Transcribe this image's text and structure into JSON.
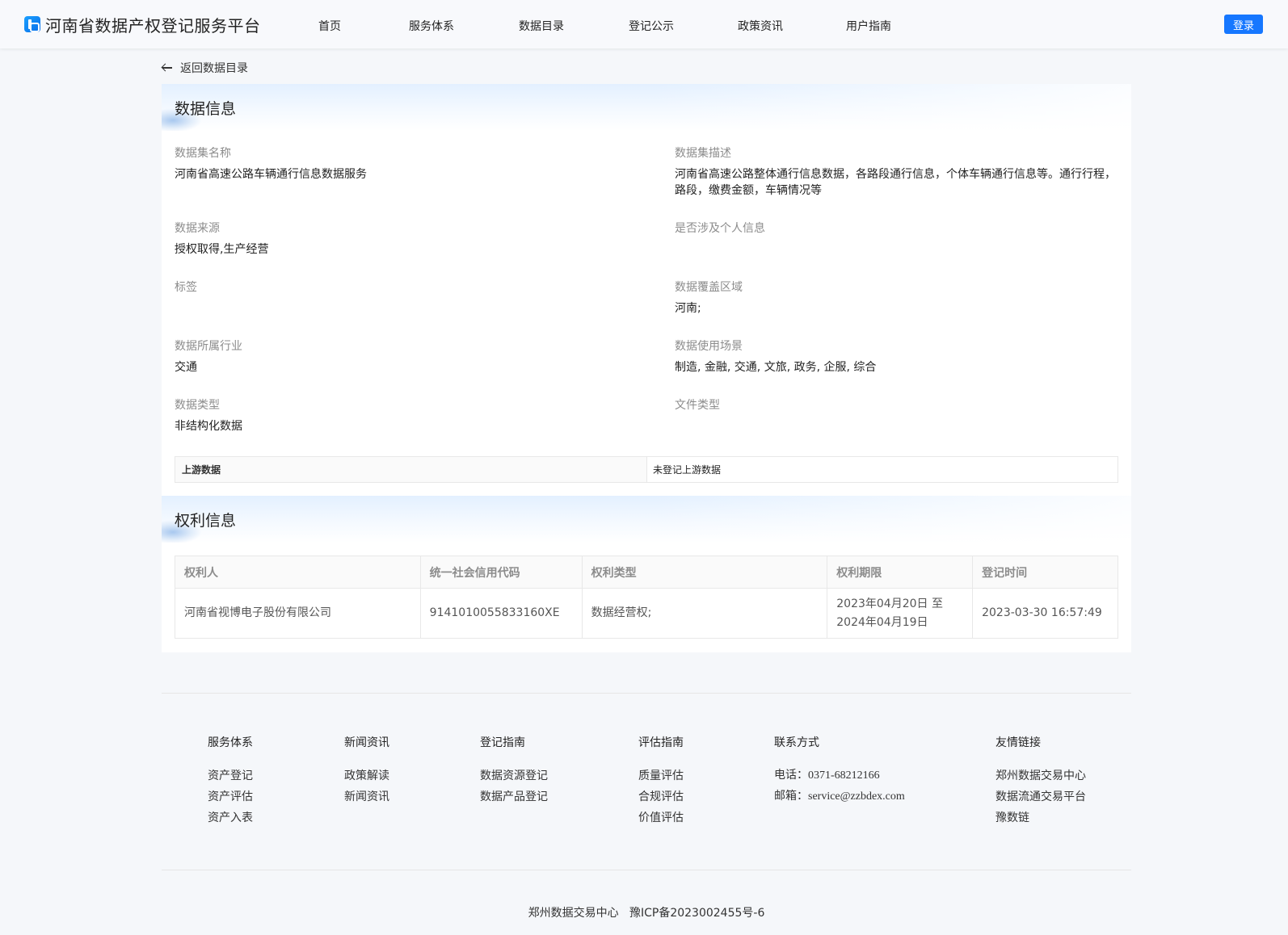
{
  "header": {
    "site_title": "河南省数据产权登记服务平台",
    "nav": [
      "首页",
      "服务体系",
      "数据目录",
      "登记公示",
      "政策资讯",
      "用户指南"
    ],
    "login_label": "登录"
  },
  "back_label": "返回数据目录",
  "data_info": {
    "section_title": "数据信息",
    "fields": [
      {
        "label": "数据集名称",
        "value": "河南省高速公路车辆通行信息数据服务"
      },
      {
        "label": "数据集描述",
        "value": "河南省高速公路整体通行信息数据，各路段通行信息，个体车辆通行信息等。通行行程，路段，缴费金额，车辆情况等"
      },
      {
        "label": "数据来源",
        "value": "授权取得,生产经营"
      },
      {
        "label": "是否涉及个人信息",
        "value": ""
      },
      {
        "label": "标签",
        "value": ""
      },
      {
        "label": "数据覆盖区域",
        "value": "河南;"
      },
      {
        "label": "数据所属行业",
        "value": "交通"
      },
      {
        "label": "数据使用场景",
        "value": "制造, 金融, 交通, 文旅, 政务, 企服, 综合"
      },
      {
        "label": "数据类型",
        "value": "非结构化数据"
      },
      {
        "label": "文件类型",
        "value": ""
      }
    ],
    "upstream": {
      "key": "上游数据",
      "value": "未登记上游数据"
    }
  },
  "rights_info": {
    "section_title": "权利信息",
    "columns": [
      "权利人",
      "统一社会信用代码",
      "权利类型",
      "权利期限",
      "登记时间"
    ],
    "rows": [
      {
        "holder": "河南省视博电子股份有限公司",
        "credit_code": "9141010055833160XE",
        "right_type": "数据经营权;",
        "period_start": "2023年04月20日 至",
        "period_end": "2024年04月19日",
        "registered_at": "2023-03-30 16:57:49"
      }
    ]
  },
  "footer": {
    "columns": [
      {
        "title": "服务体系",
        "links": [
          "资产登记",
          "资产评估",
          "资产入表"
        ]
      },
      {
        "title": "新闻资讯",
        "links": [
          "政策解读",
          "新闻资讯"
        ]
      },
      {
        "title": "登记指南",
        "links": [
          "数据资源登记",
          "数据产品登记"
        ]
      },
      {
        "title": "评估指南",
        "links": [
          "质量评估",
          "合规评估",
          "价值评估"
        ]
      },
      {
        "title": "联系方式",
        "links": [
          "电话：0371-68212166",
          "邮箱：service@zzbdex.com"
        ]
      },
      {
        "title": "友情链接",
        "links": [
          "郑州数据交易中心",
          "数据流通交易平台",
          "豫数链"
        ]
      }
    ],
    "copyright": "郑州数据交易中心   豫ICP备2023002455号-6"
  },
  "colors": {
    "primary": "#1677ff",
    "page_bg": "#f5f7fa"
  }
}
